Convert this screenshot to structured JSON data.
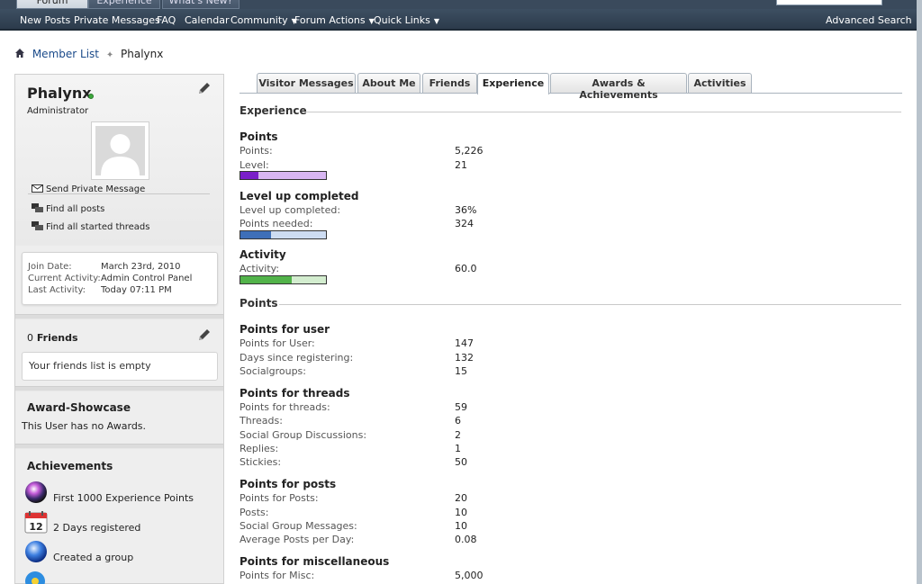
{
  "top_tabs": [
    {
      "label": "Forum",
      "active": true
    },
    {
      "label": "Experience",
      "active": false
    },
    {
      "label": "What's New?",
      "active": false
    }
  ],
  "navbar": {
    "items": [
      {
        "label": "New Posts",
        "dropdown": false
      },
      {
        "label": "Private Messages",
        "dropdown": false
      },
      {
        "label": "FAQ",
        "dropdown": false
      },
      {
        "label": "Calendar",
        "dropdown": false
      },
      {
        "label": "Community",
        "dropdown": true
      },
      {
        "label": "Forum Actions",
        "dropdown": true
      },
      {
        "label": "Quick Links",
        "dropdown": true
      }
    ],
    "advanced_search": "Advanced Search"
  },
  "breadcrumb": {
    "link": "Member List",
    "current": "Phalynx"
  },
  "profile": {
    "username": "Phalynx",
    "usertitle": "Administrator",
    "links": [
      "Send Private Message",
      "Find all posts",
      "Find all started threads"
    ],
    "info": [
      {
        "key": "Join Date:",
        "value": "March 23rd, 2010"
      },
      {
        "key": "Current Activity:",
        "value": "Admin Control Panel"
      },
      {
        "key": "Last Activity:",
        "value": "Today 07:11 PM"
      }
    ]
  },
  "friends": {
    "count": "0",
    "label": "Friends",
    "empty_text": "Your friends list is empty"
  },
  "awards": {
    "title": "Award-Showcase",
    "empty_text": "This User has no Awards."
  },
  "achievements": {
    "title": "Achievements",
    "items": [
      {
        "label": "First 1000 Experience Points",
        "icon": "orb-icon"
      },
      {
        "label": "2 Days registered",
        "icon": "calendar-icon"
      },
      {
        "label": "Created a group",
        "icon": "globe-icon"
      }
    ],
    "calendar_day": "12"
  },
  "tabs": [
    {
      "label": "Visitor Messages",
      "active": false
    },
    {
      "label": "About Me",
      "active": false
    },
    {
      "label": "Friends",
      "active": false
    },
    {
      "label": "Experience",
      "active": true
    },
    {
      "label": "Awards & Achievements",
      "active": false
    },
    {
      "label": "Activities",
      "active": false
    }
  ],
  "experience": {
    "section_title": "Experience",
    "points": {
      "title": "Points",
      "rows": [
        {
          "label": "Points:",
          "value": "5,226"
        },
        {
          "label": "Level:",
          "value": "21"
        }
      ],
      "bar_fraction": 0.21
    },
    "levelup": {
      "title": "Level up completed",
      "rows": [
        {
          "label": "Level up completed:",
          "value": "36%"
        },
        {
          "label": "Points needed:",
          "value": "324"
        }
      ],
      "bar_fraction": 0.36
    },
    "activity": {
      "title": "Activity",
      "rows": [
        {
          "label": "Activity:",
          "value": "60.0"
        }
      ],
      "bar_fraction": 0.6
    }
  },
  "points_section": {
    "section_title": "Points",
    "user": {
      "title": "Points for user",
      "rows": [
        {
          "label": "Points for User:",
          "value": "147"
        },
        {
          "label": "Days since registering:",
          "value": "132"
        },
        {
          "label": "Socialgroups:",
          "value": "15"
        }
      ]
    },
    "threads": {
      "title": "Points for threads",
      "rows": [
        {
          "label": "Points for threads:",
          "value": "59"
        },
        {
          "label": "Threads:",
          "value": "6"
        },
        {
          "label": "Social Group Discussions:",
          "value": "2"
        },
        {
          "label": "Replies:",
          "value": "1"
        },
        {
          "label": "Stickies:",
          "value": "50"
        }
      ]
    },
    "posts": {
      "title": "Points for posts",
      "rows": [
        {
          "label": "Points for Posts:",
          "value": "20"
        },
        {
          "label": "Posts:",
          "value": "10"
        },
        {
          "label": "Social Group Messages:",
          "value": "10"
        },
        {
          "label": "Average Posts per Day:",
          "value": "0.08"
        }
      ]
    },
    "misc": {
      "title": "Points for miscellaneous",
      "rows": [
        {
          "label": "Points for Misc:",
          "value": "5,000"
        }
      ]
    }
  },
  "colors": {
    "navbar": "#2c3b4c",
    "link": "#1a4a8a",
    "points_bar": "#7a1fc9",
    "points_track": "#d8b6f2",
    "levelup_bar": "#3e6fb8",
    "levelup_track": "#cddcf2",
    "activity_bar": "#52b34a",
    "activity_track": "#d3edcf"
  }
}
